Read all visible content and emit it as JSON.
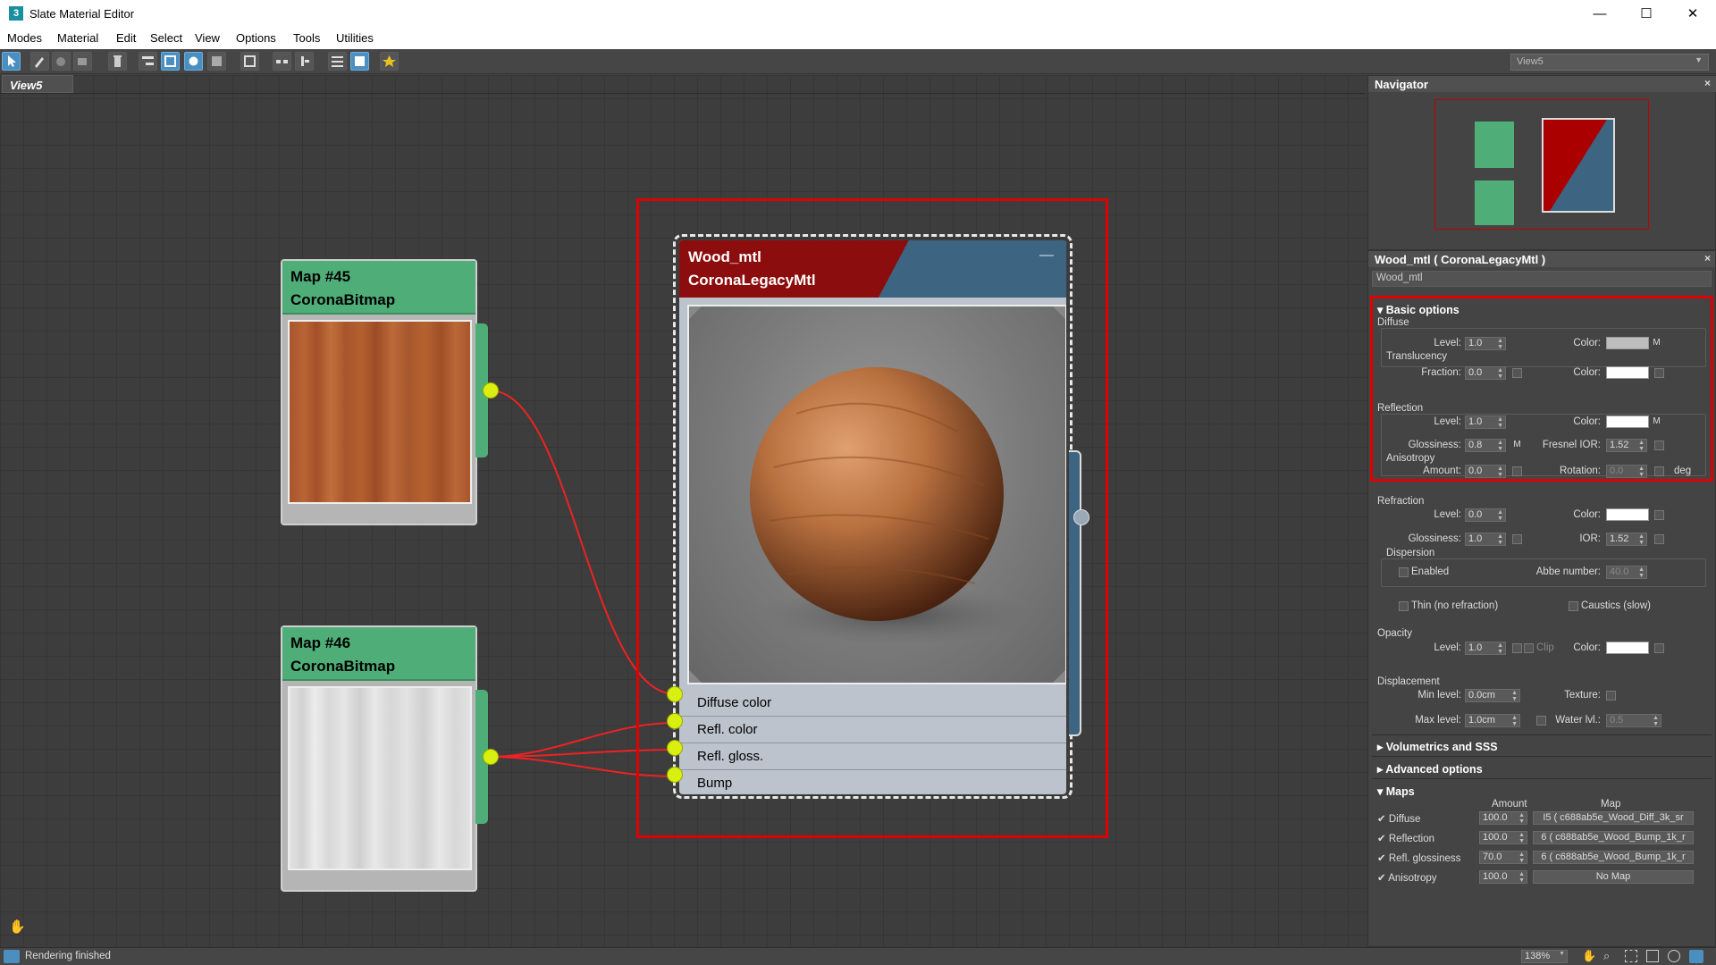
{
  "window": {
    "title": "Slate Material Editor",
    "app_icon": "3",
    "minimize": "—",
    "maximize": "☐",
    "close": "✕"
  },
  "menu": [
    "Modes",
    "Material",
    "Edit",
    "Select",
    "View",
    "Options",
    "Tools",
    "Utilities"
  ],
  "toolbar": {
    "view_dropdown": "View5"
  },
  "graph": {
    "view_tab": "View5",
    "map45": {
      "title": "Map #45",
      "type": "CoronaBitmap"
    },
    "map46": {
      "title": "Map #46",
      "type": "CoronaBitmap"
    },
    "material": {
      "name": "Wood_mtl",
      "type": "CoronaLegacyMtl",
      "minimize": "—",
      "slots": [
        "Diffuse color",
        "Refl. color",
        "Refl. gloss.",
        "Bump"
      ]
    }
  },
  "navigator": {
    "title": "Navigator",
    "close": "×"
  },
  "props": {
    "header": "Wood_mtl  ( CoronaLegacyMtl )",
    "close": "×",
    "name_field": "Wood_mtl",
    "basic_options": "Basic options",
    "diffuse": "Diffuse",
    "level_label": "Level:",
    "color_label": "Color:",
    "diffuse_level": "1.0",
    "m": "M",
    "translucency": "Translucency",
    "fraction_label": "Fraction:",
    "fraction": "0.0",
    "reflection": "Reflection",
    "refl_level": "1.0",
    "glossiness_label": "Glossiness:",
    "refl_gloss": "0.8",
    "fresnel_label": "Fresnel IOR:",
    "fresnel": "1.52",
    "anisotropy": "Anisotropy",
    "amount_label": "Amount:",
    "aniso_amount": "0.0",
    "rotation_label": "Rotation:",
    "rotation": "0.0",
    "deg": "deg",
    "refraction": "Refraction",
    "refr_level": "0.0",
    "refr_gloss": "1.0",
    "ior_label": "IOR:",
    "ior": "1.52",
    "dispersion": "Dispersion",
    "enabled": "Enabled",
    "abbe_label": "Abbe number:",
    "abbe": "40.0",
    "thin": "Thin (no refraction)",
    "caustics": "Caustics (slow)",
    "opacity": "Opacity",
    "opacity_level": "1.0",
    "clip": "Clip",
    "displacement": "Displacement",
    "min_label": "Min level:",
    "min": "0.0cm",
    "texture_label": "Texture:",
    "max_label": "Max level:",
    "max": "1.0cm",
    "water_label": "Water lvl.:",
    "water": "0.5",
    "volumetrics": "Volumetrics and SSS",
    "advanced": "Advanced options",
    "maps": "Maps",
    "maps_amount": "Amount",
    "maps_map": "Map",
    "map_rows": [
      {
        "label": "Diffuse",
        "amount": "100.0",
        "map": "I5 ( c688ab5e_Wood_Diff_3k_sr"
      },
      {
        "label": "Reflection",
        "amount": "100.0",
        "map": "6 ( c688ab5e_Wood_Bump_1k_r"
      },
      {
        "label": "Refl. glossiness",
        "amount": "70.0",
        "map": "6 ( c688ab5e_Wood_Bump_1k_r"
      },
      {
        "label": "Anisotropy",
        "amount": "100.0",
        "map": "No Map"
      }
    ]
  },
  "status": {
    "text": "Rendering finished",
    "zoom": "138%"
  }
}
